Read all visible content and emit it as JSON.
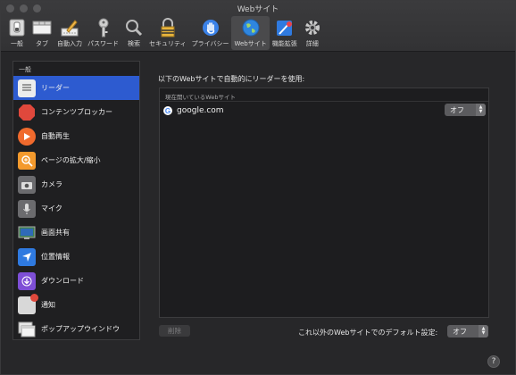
{
  "window": {
    "title": "Webサイト"
  },
  "toolbar": {
    "tabs": [
      {
        "label": "一般",
        "icon": "switch-icon"
      },
      {
        "label": "タブ",
        "icon": "tabs-icon"
      },
      {
        "label": "自動入力",
        "icon": "pencil-form-icon"
      },
      {
        "label": "パスワード",
        "icon": "key-icon"
      },
      {
        "label": "検索",
        "icon": "magnifier-icon"
      },
      {
        "label": "セキュリティ",
        "icon": "lock-icon"
      },
      {
        "label": "プライバシー",
        "icon": "hand-icon"
      },
      {
        "label": "Webサイト",
        "icon": "globe-icon",
        "selected": true
      },
      {
        "label": "機能拡張",
        "icon": "puzzle-icon"
      },
      {
        "label": "詳細",
        "icon": "gear-icon"
      }
    ]
  },
  "sidebar": {
    "header": "一般",
    "items": [
      {
        "label": "リーダー",
        "icon": "reader-icon",
        "color": "#e8e8e8",
        "selected": true
      },
      {
        "label": "コンテンツブロッカー",
        "icon": "stop-icon",
        "color": "#e0483c"
      },
      {
        "label": "自動再生",
        "icon": "play-icon",
        "color": "#f06a2d"
      },
      {
        "label": "ページの拡大/縮小",
        "icon": "zoom-icon",
        "color": "#f49a2d"
      },
      {
        "label": "カメラ",
        "icon": "camera-icon",
        "color": "#6b6b6e"
      },
      {
        "label": "マイク",
        "icon": "microphone-icon",
        "color": "#6b6b6e"
      },
      {
        "label": "画面共有",
        "icon": "screen-share-icon",
        "color": "#3f7f4f"
      },
      {
        "label": "位置情報",
        "icon": "location-icon",
        "color": "#2f7ae0"
      },
      {
        "label": "ダウンロード",
        "icon": "download-icon",
        "color": "#7e4fd6"
      },
      {
        "label": "通知",
        "icon": "notification-icon",
        "color": "#d8d8d8"
      },
      {
        "label": "ポップアップウインドウ",
        "icon": "popup-icon",
        "color": "#d8d8d8"
      }
    ]
  },
  "main": {
    "description": "以下のWebサイトで自動的にリーダーを使用:",
    "table": {
      "header": "現在開いているWebサイト",
      "rows": [
        {
          "site": "google.com",
          "setting": "オフ"
        }
      ]
    },
    "delete_label": "削除",
    "default_label": "これ以外のWebサイトでのデフォルト設定:",
    "default_value": "オフ",
    "help": "?"
  },
  "colors": {
    "accent": "#2d5bd0",
    "background": "#272729"
  }
}
